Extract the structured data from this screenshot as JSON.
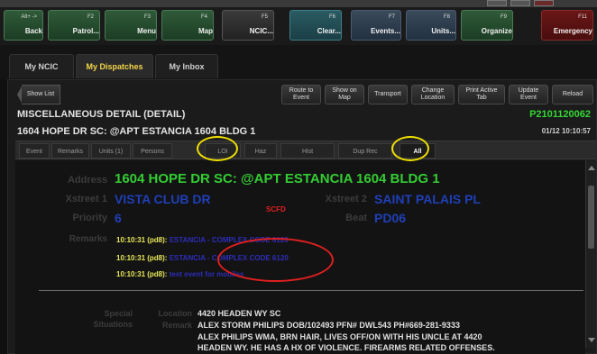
{
  "titlebar": {
    "title": ""
  },
  "fkeys": [
    {
      "num": "Alt+ ->",
      "label": "Back",
      "style": "green"
    },
    {
      "num": "F2",
      "label": "Patrol...",
      "style": "green"
    },
    {
      "num": "F3",
      "label": "Menu",
      "style": "green"
    },
    {
      "num": "F4",
      "label": "Map",
      "style": "green"
    },
    {
      "num": "F5",
      "label": "NCIC...",
      "style": "green"
    },
    {
      "num": "F6",
      "label": "Clear...",
      "style": "teal"
    },
    {
      "num": "F7",
      "label": "Events...",
      "style": "green"
    },
    {
      "num": "F8",
      "label": "Units...",
      "style": "green"
    },
    {
      "num": "F9",
      "label": "Organize",
      "style": "green"
    },
    {
      "num": "F11",
      "label": "Emergency",
      "style": "red"
    }
  ],
  "tabs": [
    {
      "label": "My NCIC"
    },
    {
      "label": "My Dispatches",
      "active": true
    },
    {
      "label": "My Inbox"
    }
  ],
  "actions": {
    "show_list": "Show List",
    "route_to_event": [
      "Route to",
      "Event"
    ],
    "show_on_map": [
      "Show on",
      "Map"
    ],
    "transport": "Transport",
    "change_location": [
      "Change",
      "Location"
    ],
    "print_active_tab": [
      "Print Active",
      "Tab"
    ],
    "update_event": [
      "Update",
      "Event"
    ],
    "reload": "Reload"
  },
  "detail": {
    "title": "MISCELLANEOUS DETAIL (DETAIL)",
    "event_id": "P2101120062",
    "address_header": "1604 HOPE DR SC: @APT ESTANCIA 1604 BLDG 1",
    "datetime": "01/12 10:10:57"
  },
  "subtabs": [
    {
      "label": "Event"
    },
    {
      "label": "Remarks"
    },
    {
      "label": "Units (1)"
    },
    {
      "label": "Persons"
    },
    {
      "label": "LOI"
    },
    {
      "label": "Haz"
    },
    {
      "label": "Hist"
    },
    {
      "label": "Dup Rec"
    },
    {
      "label": "All",
      "active": true
    }
  ],
  "fields": {
    "address_label": "Address",
    "address_value": "1604 HOPE DR SC: @APT ESTANCIA 1604 BLDG 1",
    "xstreet1_label": "Xstreet 1",
    "xstreet1_value": "VISTA CLUB DR",
    "xstreet2_label": "Xstreet 2",
    "xstreet2_value": "SAINT PALAIS PL",
    "priority_label": "Priority",
    "priority_value": "6",
    "beat_label": "Beat",
    "beat_value": "PD06",
    "agency_tag": "SCFD",
    "remarks_label": "Remarks",
    "remarks": [
      {
        "time": "10:10:31 (pd8):",
        "text": "ESTANCIA - COMPLEX CODE 6120"
      },
      {
        "time": "10:10:31 (pd8):",
        "text": "ESTANCIA - COMPLEX CODE 6120"
      },
      {
        "time": "10:10:31 (pd8):",
        "text": "test event for mobiles"
      }
    ]
  },
  "special": {
    "label_line1": "Special",
    "label_line2": "Situations",
    "location_label": "Location",
    "location_value": "4420 HEADEN WY SC",
    "remark_label": "Remark",
    "remark_lines": [
      "ALEX STORM PHILIPS DOB/102493 PFN# DWL543 PH#669-281-9333",
      "ALEX PHILIPS WMA, BRN HAIR, LIVES OFF/ON WITH HIS UNCLE AT 4420",
      "HEADEN WY. HE HAS A HX OF VIOLENCE. FIREARMS RELATED OFFENSES."
    ]
  },
  "colors": {
    "accent_green": "#33cc33",
    "accent_blue": "#1f3fb8",
    "tab_active": "#f4d64a",
    "annotation_yellow": "#f0e000",
    "annotation_red": "#e01f1f"
  }
}
